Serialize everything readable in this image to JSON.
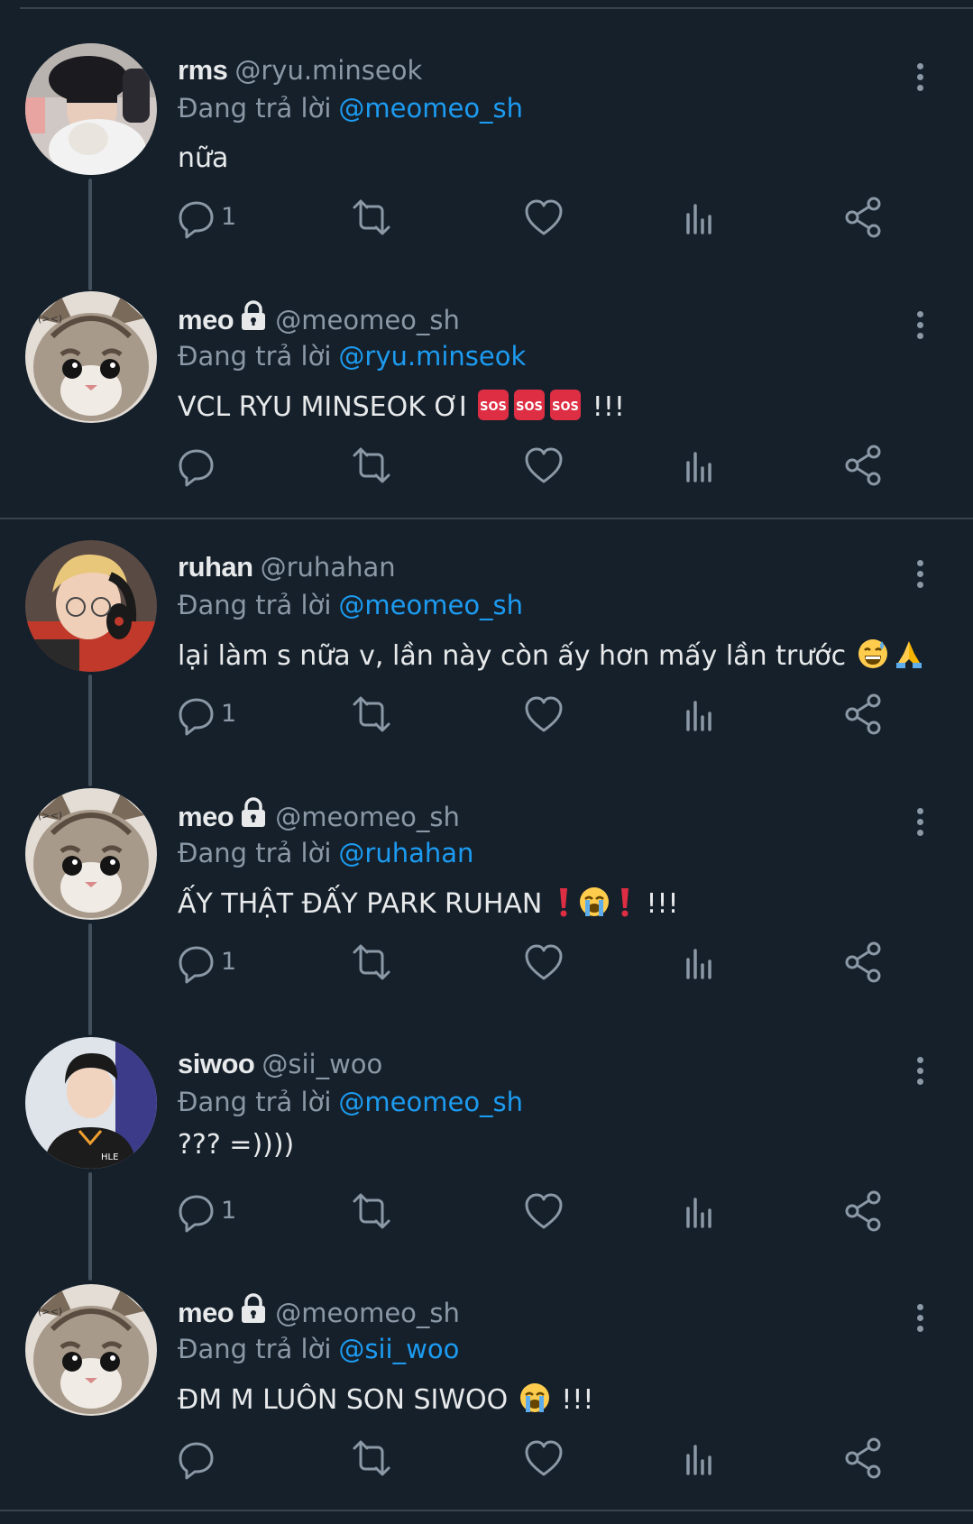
{
  "colors": {
    "background": "#15202b",
    "divider": "#38444d",
    "text": "#e7e9ea",
    "muted": "#8b98a5",
    "link": "#1d9bf0"
  },
  "reply_prefix": "Đang trả lời",
  "tweets": [
    {
      "name": "rms",
      "handle": "@ryu.minseok",
      "locked": false,
      "reply_to": "@meomeo_sh",
      "text": "nữa",
      "emoji_tail": "",
      "reply_count": "1",
      "avatar_icon": "person-avatar-icon"
    },
    {
      "name": "meo",
      "handle": "@meomeo_sh",
      "locked": true,
      "reply_to": "@ryu.minseok",
      "text": "VCL RYU MINSEOK ƠI",
      "emoji_tail": "!!!",
      "emojis": [
        "sos",
        "sos",
        "sos"
      ],
      "reply_count": "",
      "avatar_icon": "kitten-avatar-icon"
    },
    {
      "name": "ruhan",
      "handle": "@ruhahan",
      "locked": false,
      "reply_to": "@meomeo_sh",
      "text": "lại làm s nữa v, lần này còn ấy hơn mấy lần trước",
      "emoji_tail": "",
      "emojis": [
        "sweat-smile",
        "pray"
      ],
      "reply_count": "1",
      "avatar_icon": "person-headset-avatar-icon"
    },
    {
      "name": "meo",
      "handle": "@meomeo_sh",
      "locked": true,
      "reply_to": "@ruhahan",
      "text": "ẤY THẬT ĐẤY PARK RUHAN",
      "emoji_tail": "!!!",
      "emojis": [
        "exclamation",
        "crying",
        "exclamation"
      ],
      "reply_count": "1",
      "avatar_icon": "kitten-avatar-icon"
    },
    {
      "name": "siwoo",
      "handle": "@sii_woo",
      "locked": false,
      "reply_to": "@meomeo_sh",
      "text": "??? =))))",
      "emoji_tail": "",
      "reply_count": "1",
      "avatar_icon": "person-jersey-avatar-icon"
    },
    {
      "name": "meo",
      "handle": "@meomeo_sh",
      "locked": true,
      "reply_to": "@sii_woo",
      "text": "ĐM M LUÔN SON SIWOO",
      "emoji_tail": "!!!",
      "emojis": [
        "crying"
      ],
      "reply_count": "",
      "avatar_icon": "kitten-avatar-icon"
    }
  ]
}
